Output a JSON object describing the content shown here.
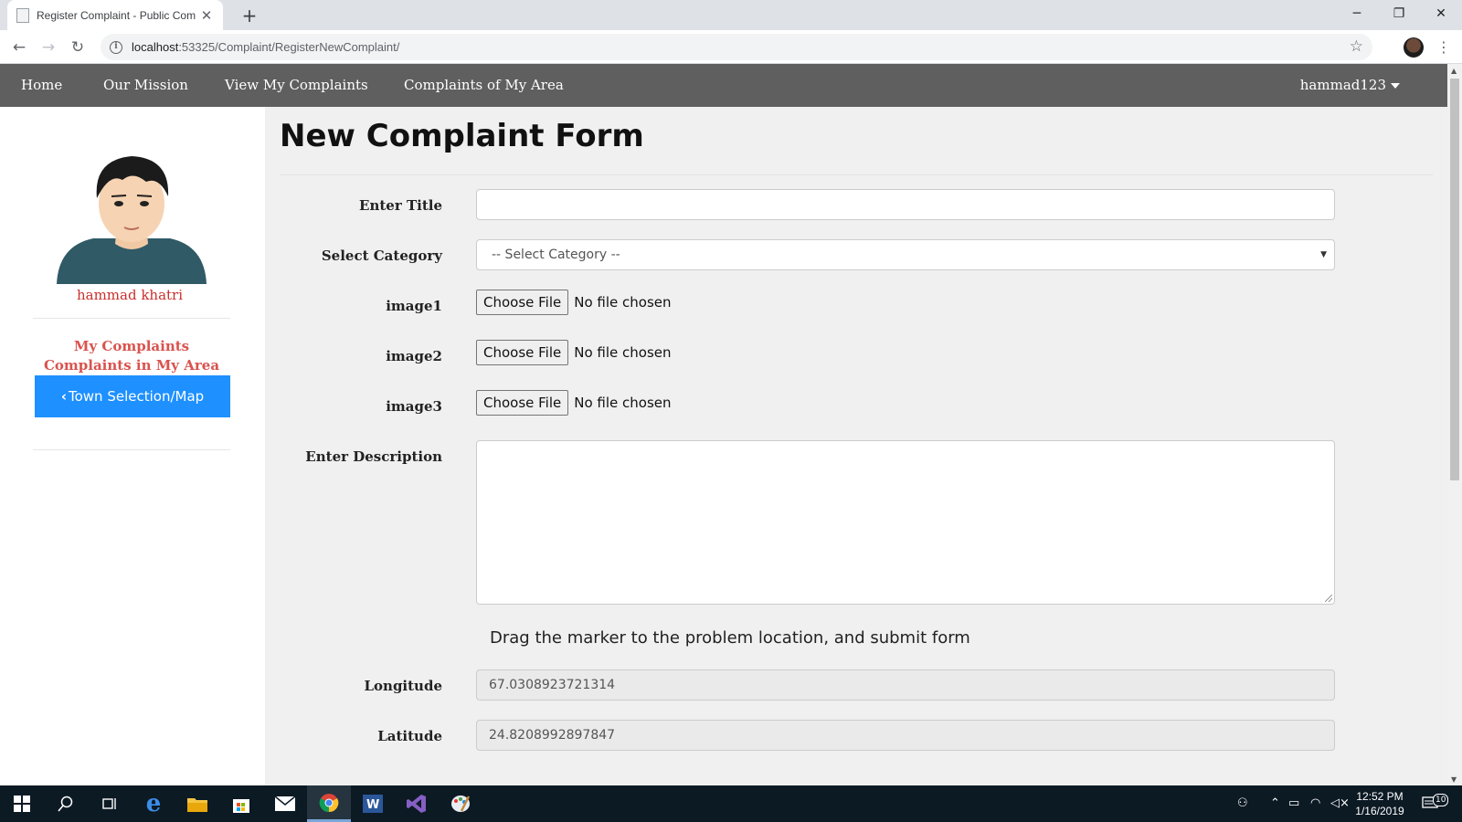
{
  "browser": {
    "tab_title": "Register Complaint - Public Com",
    "url_host": "localhost",
    "url_rest": ":53325/Complaint/RegisterNewComplaint/"
  },
  "nav": {
    "items": [
      {
        "label": "Home"
      },
      {
        "label": "Our Mission"
      },
      {
        "label": "View My Complaints"
      },
      {
        "label": "Complaints of My Area"
      }
    ],
    "user": "hammad123"
  },
  "sidebar": {
    "username": "hammad khatri",
    "link_my_complaints": "My Complaints",
    "link_area_complaints": "Complaints in My Area",
    "town_button": "Town Selection/Map"
  },
  "form": {
    "title": "New Complaint Form",
    "title_label": "Enter Title",
    "title_value": "",
    "category_label": "Select Category",
    "category_value": "-- Select Category --",
    "images": [
      {
        "label": "image1",
        "button": "Choose File",
        "status": "No file chosen"
      },
      {
        "label": "image2",
        "button": "Choose File",
        "status": "No file chosen"
      },
      {
        "label": "image3",
        "button": "Choose File",
        "status": "No file chosen"
      }
    ],
    "description_label": "Enter Description",
    "hint": "Drag the marker to the problem location, and submit form",
    "longitude_label": "Longitude",
    "longitude_value": "67.0308923721314",
    "latitude_label": "Latitude",
    "latitude_value": "24.8208992897847"
  },
  "taskbar": {
    "time": "12:52 PM",
    "date": "1/16/2019",
    "notifications": "10"
  },
  "colors": {
    "nav_bg": "#5f5f5f",
    "accent_button": "#1e90ff",
    "sidebar_link": "#d9534f"
  }
}
